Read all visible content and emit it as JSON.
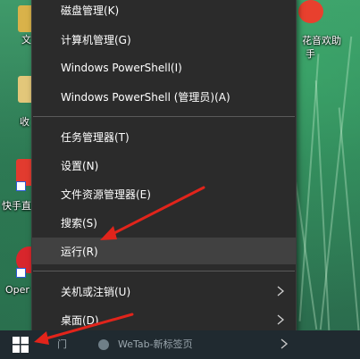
{
  "desktop": {
    "icons": [
      {
        "label": "文",
        "color": "#d9b24a"
      },
      {
        "label": "收",
        "color": "#e3c77a"
      },
      {
        "label": "快手直",
        "color": "#e23b2f"
      },
      {
        "label": "Oper",
        "color": "#d8262c"
      }
    ],
    "right_widget": {
      "label_line1": "花音欢助",
      "label_line2": "手",
      "color": "#e8402e"
    }
  },
  "context_menu": {
    "items": [
      {
        "label": "磁盘管理(K)"
      },
      {
        "label": "计算机管理(G)"
      },
      {
        "label": "Windows PowerShell(I)"
      },
      {
        "label": "Windows PowerShell (管理员)(A)"
      },
      {
        "label": "任务管理器(T)"
      },
      {
        "label": "设置(N)"
      },
      {
        "label": "文件资源管理器(E)"
      },
      {
        "label": "搜索(S)"
      },
      {
        "label": "运行(R)"
      },
      {
        "label": "关机或注销(U)"
      },
      {
        "label": "桌面(D)"
      }
    ]
  },
  "taskbar": {
    "left_text": "门",
    "center_text": "WeTab-新标签页"
  },
  "colors": {
    "menu_bg": "#2b2b2b",
    "menu_highlight": "#414141",
    "menu_text": "#ffffff",
    "arrow": "#e1241b",
    "taskbar_bg": "#202a30",
    "start_icon": "#ffffff"
  }
}
